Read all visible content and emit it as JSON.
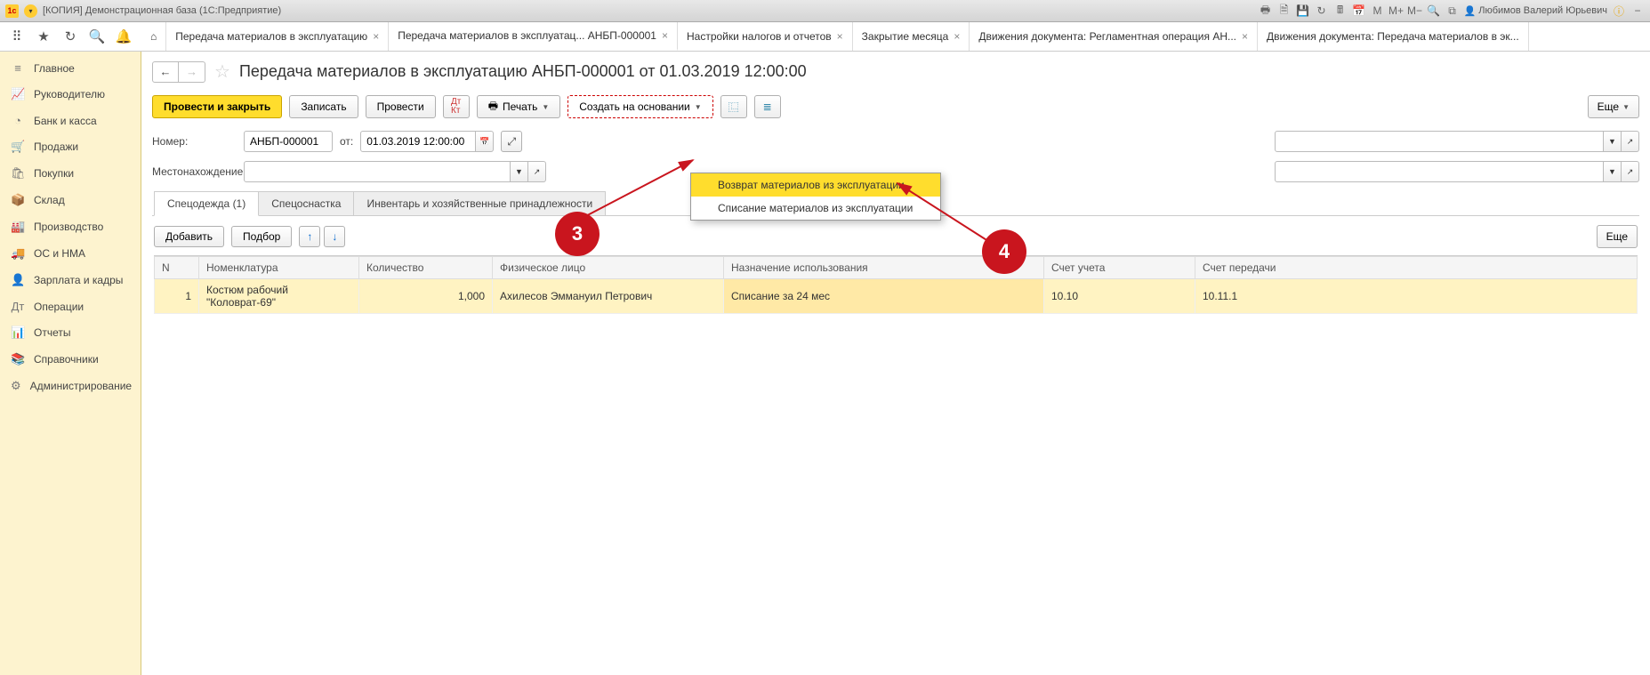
{
  "titlebar": {
    "title": "[КОПИЯ] Демонстрационная база  (1С:Предприятие)",
    "user": "Любимов Валерий Юрьевич"
  },
  "topbar_icons": {
    "m": "М",
    "mplus": "М+",
    "mminus": "М−"
  },
  "tabs": [
    {
      "label": "Передача материалов в эксплуатацию",
      "closable": true,
      "active": false
    },
    {
      "label": "Передача материалов в эксплуатац... АНБП-000001",
      "closable": true,
      "active": true
    },
    {
      "label": "Настройки налогов и отчетов",
      "closable": true,
      "active": false
    },
    {
      "label": "Закрытие месяца",
      "closable": true,
      "active": false
    },
    {
      "label": "Движения документа: Регламентная операция АН...",
      "closable": true,
      "active": false
    },
    {
      "label": "Движения документа: Передача материалов в эк...",
      "closable": false,
      "active": false
    }
  ],
  "sidebar": [
    {
      "icon": "≡",
      "label": "Главное"
    },
    {
      "icon": "📈",
      "label": "Руководителю"
    },
    {
      "icon": "◔",
      "label": "Банк и касса"
    },
    {
      "icon": "🛒",
      "label": "Продажи"
    },
    {
      "icon": "🛍",
      "label": "Покупки"
    },
    {
      "icon": "📦",
      "label": "Склад"
    },
    {
      "icon": "🏭",
      "label": "Производство"
    },
    {
      "icon": "🚚",
      "label": "ОС и НМА"
    },
    {
      "icon": "👤",
      "label": "Зарплата и кадры"
    },
    {
      "icon": "Дт",
      "label": "Операции"
    },
    {
      "icon": "📊",
      "label": "Отчеты"
    },
    {
      "icon": "📚",
      "label": "Справочники"
    },
    {
      "icon": "⚙",
      "label": "Администрирование"
    }
  ],
  "doc": {
    "title": "Передача материалов в эксплуатацию АНБП-000001 от 01.03.2019 12:00:00",
    "btn_post_close": "Провести и закрыть",
    "btn_write": "Записать",
    "btn_post": "Провести",
    "btn_print": "Печать",
    "btn_create_based": "Создать на основании",
    "btn_more": "Еще",
    "label_number": "Номер:",
    "value_number": "АНБП-000001",
    "label_from": "от:",
    "value_date": "01.03.2019 12:00:00",
    "label_location": "Местонахождение:",
    "value_location": ""
  },
  "dropdown": {
    "item1": "Возврат материалов из эксплуатации",
    "item2": "Списание материалов из эксплуатации"
  },
  "subtabs": [
    {
      "label": "Спецодежда (1)",
      "active": true
    },
    {
      "label": "Спецоснастка",
      "active": false
    },
    {
      "label": "Инвентарь и хозяйственные принадлежности",
      "active": false
    }
  ],
  "tabtools": {
    "add": "Добавить",
    "pick": "Подбор",
    "more": "Еще"
  },
  "grid": {
    "cols": {
      "n": "N",
      "nom": "Номенклатура",
      "qty": "Количество",
      "fio": "Физическое лицо",
      "nazn": "Назначение использования",
      "su": "Счет учета",
      "sp": "Счет передачи"
    },
    "rows": [
      {
        "n": "1",
        "nom": "Костюм рабочий \"Коловрат-69\"",
        "qty": "1,000",
        "fio": "Ахилесов Эммануил Петрович",
        "nazn": "Списание за 24 мес",
        "su": "10.10",
        "sp": "10.11.1"
      }
    ]
  },
  "markers": {
    "m3": "3",
    "m4": "4"
  }
}
